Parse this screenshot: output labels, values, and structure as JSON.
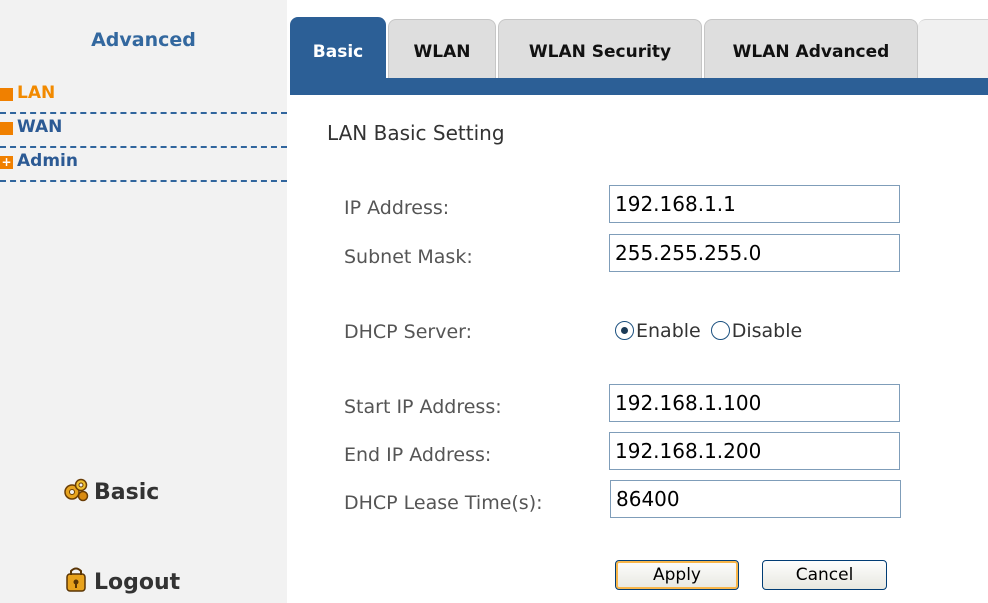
{
  "sidebar": {
    "title": "Advanced",
    "items": [
      {
        "label": "LAN",
        "active": true,
        "marker": "square"
      },
      {
        "label": "WAN",
        "active": false,
        "marker": "square"
      },
      {
        "label": "Admin",
        "active": false,
        "marker": "plus"
      }
    ],
    "basic_link": {
      "label": "Basic",
      "icon": "gears-icon"
    },
    "logout_link": {
      "label": "Logout",
      "icon": "logout-icon"
    }
  },
  "tabs": [
    {
      "label": "Basic",
      "active": true
    },
    {
      "label": "WLAN",
      "active": false
    },
    {
      "label": "WLAN Security",
      "active": false
    },
    {
      "label": "WLAN Advanced",
      "active": false
    }
  ],
  "form": {
    "section_title": "LAN Basic Setting",
    "ip_address": {
      "label": "IP Address:",
      "value": "192.168.1.1"
    },
    "subnet_mask": {
      "label": "Subnet Mask:",
      "value": "255.255.255.0"
    },
    "dhcp_server": {
      "label": "DHCP Server:",
      "options": [
        "Enable",
        "Disable"
      ],
      "selected": "Enable"
    },
    "start_ip": {
      "label": "Start IP Address:",
      "value": "192.168.1.100"
    },
    "end_ip": {
      "label": "End IP Address:",
      "value": "192.168.1.200"
    },
    "lease_time": {
      "label": "DHCP Lease Time(s):",
      "value": "86400"
    }
  },
  "buttons": {
    "apply": "Apply",
    "cancel": "Cancel"
  },
  "colors": {
    "accent_blue": "#2c5f96",
    "nav_orange": "#f08000",
    "sidebar_bg": "#f2f2f2"
  }
}
